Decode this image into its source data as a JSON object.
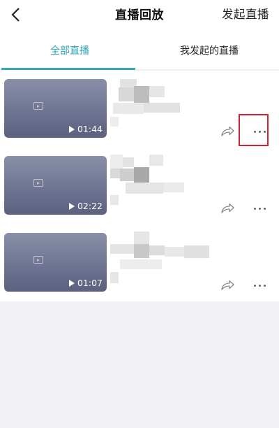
{
  "header": {
    "title": "直播回放",
    "action_label": "发起直播"
  },
  "tabs": [
    {
      "label": "全部直播",
      "active": true
    },
    {
      "label": "我发起的直播",
      "active": false
    }
  ],
  "videos": [
    {
      "duration": "01:44"
    },
    {
      "duration": "02:22"
    },
    {
      "duration": "01:07"
    }
  ],
  "colors": {
    "accent": "#2aa3b3",
    "highlight": "#d2202f",
    "thumbnail": "#6d7290"
  },
  "icons": {
    "back": "chevron-left-icon",
    "share": "share-icon",
    "more": "more-horizontal-icon",
    "play": "play-icon"
  }
}
